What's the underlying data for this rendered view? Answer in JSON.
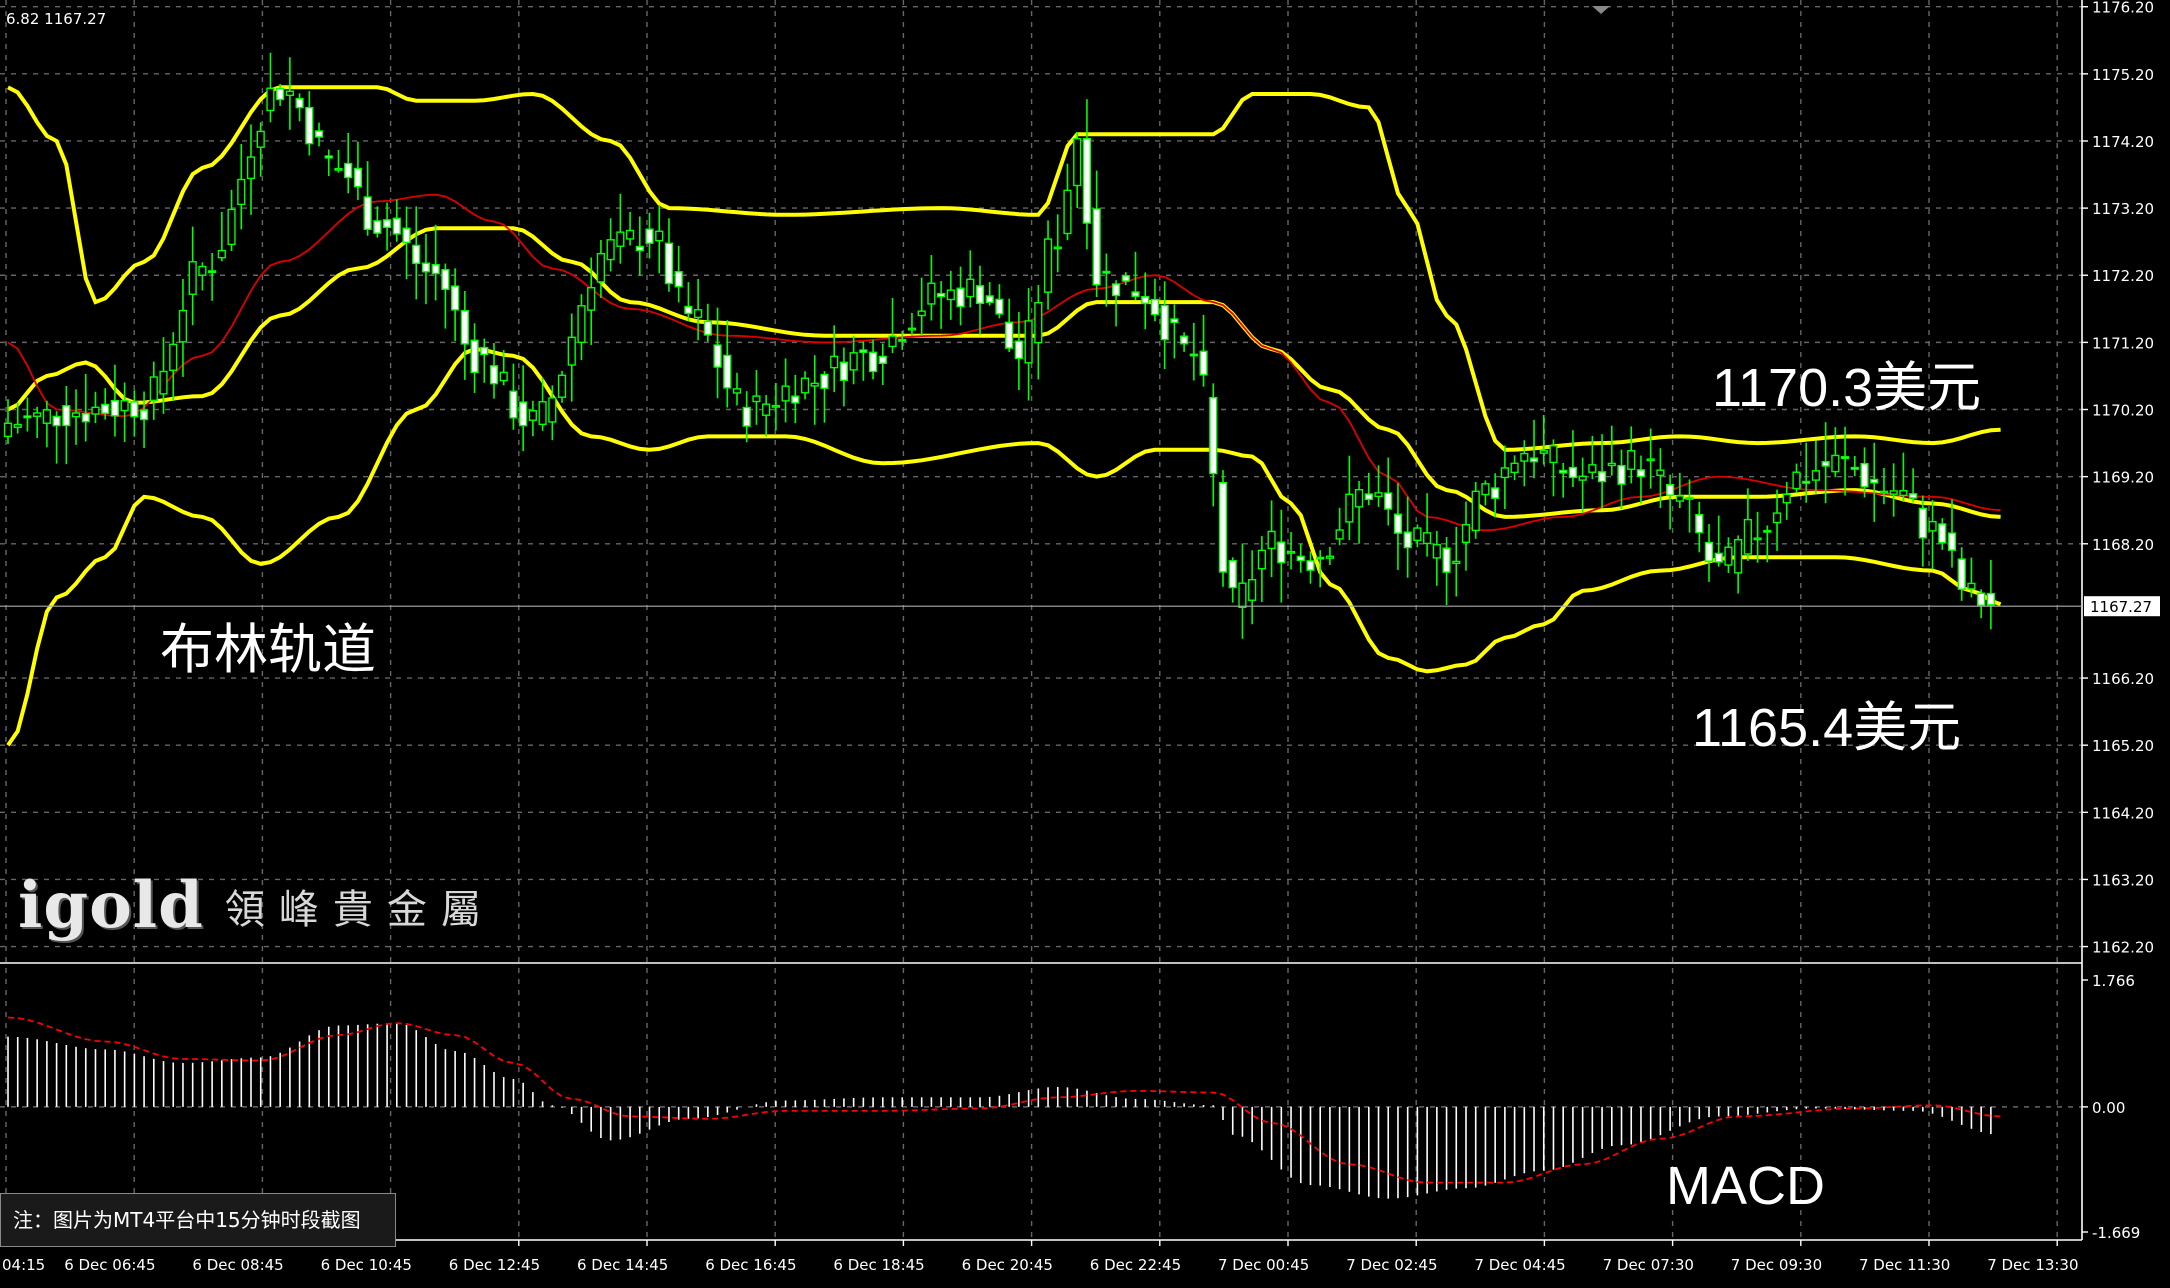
{
  "header": {
    "ohlc_readout": "6.82 1167.27"
  },
  "annotations": {
    "bollinger_label": "布林轨道",
    "upper_value": "1170.3美元",
    "lower_value": "1165.4美元",
    "macd_label": "MACD"
  },
  "note": "注：图片为MT4平台中15分钟时段截图",
  "logo": {
    "main": "igold",
    "sub": "領峰貴金屬"
  },
  "colors": {
    "background": "#000000",
    "grid": "#666666",
    "bull": "#00ff00",
    "bear": "#ffffff",
    "bollinger": "#ffff00",
    "ma": "#dd0000",
    "macd_hist": "#ffffff",
    "macd_signal": "#ff0000"
  },
  "chart_data": {
    "type": "candlestick",
    "price_axis": {
      "ticks": [
        "1176.20",
        "1175.20",
        "1174.20",
        "1173.20",
        "1172.20",
        "1171.20",
        "1170.20",
        "1169.20",
        "1168.20",
        "1167.27",
        "1166.20",
        "1165.20",
        "1164.20",
        "1163.20",
        "1162.20"
      ],
      "ylim": [
        1162.0,
        1176.3
      ],
      "current_price": 1167.27,
      "current_label": "1167.27"
    },
    "macd_axis": {
      "ticks": [
        "1.766",
        "0.00",
        "-1.669"
      ],
      "ylim": [
        -1.669,
        1.766
      ]
    },
    "time_labels": [
      "04:15",
      "6 Dec 06:45",
      "6 Dec 08:45",
      "6 Dec 10:45",
      "6 Dec 12:45",
      "6 Dec 14:45",
      "6 Dec 16:45",
      "6 Dec 18:45",
      "6 Dec 20:45",
      "6 Dec 22:45",
      "7 Dec 00:45",
      "7 Dec 02:45",
      "7 Dec 04:45",
      "7 Dec 07:30",
      "7 Dec 09:30",
      "7 Dec 11:30",
      "7 Dec 13:30"
    ],
    "anchors": {
      "close": [
        [
          0,
          1170.0
        ],
        [
          8,
          1170.2
        ],
        [
          14,
          1170.3
        ],
        [
          20,
          1172.3
        ],
        [
          28,
          1175.0
        ],
        [
          34,
          1173.8
        ],
        [
          38,
          1173.0
        ],
        [
          44,
          1172.2
        ],
        [
          48,
          1171.0
        ],
        [
          54,
          1170.0
        ],
        [
          62,
          1172.6
        ],
        [
          66,
          1172.8
        ],
        [
          70,
          1171.6
        ],
        [
          76,
          1170.2
        ],
        [
          82,
          1170.6
        ],
        [
          88,
          1171.0
        ],
        [
          96,
          1171.9
        ],
        [
          100,
          1172.0
        ],
        [
          104,
          1171.0
        ],
        [
          108,
          1172.8
        ],
        [
          110,
          1174.3
        ],
        [
          112,
          1172.2
        ],
        [
          116,
          1172.0
        ],
        [
          122,
          1171.0
        ],
        [
          126,
          1167.3
        ],
        [
          130,
          1168.2
        ],
        [
          134,
          1168.0
        ],
        [
          140,
          1169.0
        ],
        [
          144,
          1168.2
        ],
        [
          148,
          1168.0
        ],
        [
          152,
          1169.0
        ],
        [
          156,
          1169.6
        ],
        [
          162,
          1169.2
        ],
        [
          168,
          1169.4
        ],
        [
          172,
          1168.8
        ],
        [
          176,
          1167.8
        ],
        [
          180,
          1168.4
        ],
        [
          184,
          1169.2
        ],
        [
          188,
          1169.4
        ],
        [
          194,
          1169.0
        ],
        [
          198,
          1168.4
        ],
        [
          202,
          1167.4
        ],
        [
          205,
          1167.27
        ]
      ],
      "upper_band": [
        [
          0,
          1175.0
        ],
        [
          5,
          1174.2
        ],
        [
          9,
          1171.8
        ],
        [
          14,
          1172.4
        ],
        [
          20,
          1173.8
        ],
        [
          28,
          1175.0
        ],
        [
          38,
          1175.0
        ],
        [
          42,
          1174.8
        ],
        [
          48,
          1174.8
        ],
        [
          54,
          1174.9
        ],
        [
          62,
          1174.2
        ],
        [
          68,
          1173.2
        ],
        [
          80,
          1173.1
        ],
        [
          96,
          1173.2
        ],
        [
          106,
          1173.1
        ],
        [
          110,
          1174.3
        ],
        [
          116,
          1174.3
        ],
        [
          124,
          1174.3
        ],
        [
          128,
          1174.9
        ],
        [
          134,
          1174.9
        ],
        [
          140,
          1174.7
        ],
        [
          144,
          1173.2
        ],
        [
          148,
          1171.6
        ],
        [
          154,
          1169.6
        ],
        [
          164,
          1169.7
        ],
        [
          172,
          1169.8
        ],
        [
          180,
          1169.7
        ],
        [
          190,
          1169.8
        ],
        [
          198,
          1169.7
        ],
        [
          205,
          1169.9
        ]
      ],
      "middle_band": [
        [
          0,
          1170.2
        ],
        [
          4,
          1170.7
        ],
        [
          8,
          1170.9
        ],
        [
          13,
          1170.3
        ],
        [
          20,
          1170.4
        ],
        [
          28,
          1171.6
        ],
        [
          36,
          1172.3
        ],
        [
          44,
          1172.9
        ],
        [
          52,
          1172.9
        ],
        [
          58,
          1172.4
        ],
        [
          64,
          1171.8
        ],
        [
          72,
          1171.5
        ],
        [
          84,
          1171.3
        ],
        [
          96,
          1171.3
        ],
        [
          106,
          1171.3
        ],
        [
          112,
          1171.8
        ],
        [
          118,
          1171.8
        ],
        [
          124,
          1171.8
        ],
        [
          130,
          1171.1
        ],
        [
          136,
          1170.5
        ],
        [
          142,
          1169.9
        ],
        [
          148,
          1169.0
        ],
        [
          154,
          1168.6
        ],
        [
          164,
          1168.7
        ],
        [
          172,
          1168.9
        ],
        [
          180,
          1168.9
        ],
        [
          190,
          1169.0
        ],
        [
          198,
          1168.8
        ],
        [
          205,
          1168.6
        ]
      ],
      "lower_band": [
        [
          0,
          1165.2
        ],
        [
          5,
          1167.4
        ],
        [
          10,
          1168.0
        ],
        [
          14,
          1168.9
        ],
        [
          20,
          1168.6
        ],
        [
          26,
          1167.9
        ],
        [
          34,
          1168.6
        ],
        [
          42,
          1170.2
        ],
        [
          48,
          1171.1
        ],
        [
          52,
          1171.0
        ],
        [
          60,
          1169.8
        ],
        [
          66,
          1169.6
        ],
        [
          72,
          1169.8
        ],
        [
          80,
          1169.8
        ],
        [
          90,
          1169.4
        ],
        [
          106,
          1169.7
        ],
        [
          112,
          1169.2
        ],
        [
          118,
          1169.6
        ],
        [
          124,
          1169.6
        ],
        [
          128,
          1169.5
        ],
        [
          132,
          1168.8
        ],
        [
          136,
          1167.6
        ],
        [
          142,
          1166.5
        ],
        [
          146,
          1166.3
        ],
        [
          150,
          1166.4
        ],
        [
          154,
          1166.8
        ],
        [
          158,
          1167.0
        ],
        [
          162,
          1167.5
        ],
        [
          170,
          1167.8
        ],
        [
          178,
          1168.0
        ],
        [
          188,
          1168.0
        ],
        [
          198,
          1167.8
        ],
        [
          202,
          1167.5
        ],
        [
          205,
          1167.3
        ]
      ],
      "moving_average": [
        [
          0,
          1171.2
        ],
        [
          5,
          1170.2
        ],
        [
          12,
          1170.1
        ],
        [
          20,
          1171.0
        ],
        [
          28,
          1172.4
        ],
        [
          38,
          1173.3
        ],
        [
          44,
          1173.4
        ],
        [
          50,
          1173.0
        ],
        [
          56,
          1172.3
        ],
        [
          64,
          1171.7
        ],
        [
          74,
          1171.3
        ],
        [
          84,
          1171.2
        ],
        [
          96,
          1171.3
        ],
        [
          104,
          1171.5
        ],
        [
          112,
          1172.0
        ],
        [
          118,
          1172.2
        ],
        [
          124,
          1171.8
        ],
        [
          130,
          1171.1
        ],
        [
          136,
          1170.3
        ],
        [
          142,
          1169.2
        ],
        [
          146,
          1168.6
        ],
        [
          152,
          1168.4
        ],
        [
          160,
          1168.6
        ],
        [
          168,
          1168.9
        ],
        [
          176,
          1169.2
        ],
        [
          186,
          1169.0
        ],
        [
          198,
          1168.9
        ],
        [
          205,
          1168.7
        ]
      ],
      "macd_hist": [
        [
          0,
          0.88
        ],
        [
          10,
          0.72
        ],
        [
          18,
          0.55
        ],
        [
          26,
          0.62
        ],
        [
          34,
          1.02
        ],
        [
          40,
          1.05
        ],
        [
          46,
          0.7
        ],
        [
          52,
          0.35
        ],
        [
          56,
          0.02
        ],
        [
          62,
          -0.42
        ],
        [
          70,
          -0.15
        ],
        [
          80,
          0.08
        ],
        [
          90,
          0.12
        ],
        [
          100,
          0.12
        ],
        [
          108,
          0.25
        ],
        [
          116,
          0.1
        ],
        [
          124,
          0.02
        ],
        [
          126,
          -0.35
        ],
        [
          134,
          -0.98
        ],
        [
          142,
          -1.15
        ],
        [
          150,
          -1.02
        ],
        [
          158,
          -0.8
        ],
        [
          166,
          -0.48
        ],
        [
          176,
          -0.12
        ],
        [
          186,
          -0.02
        ],
        [
          196,
          -0.05
        ],
        [
          205,
          -0.35
        ]
      ],
      "macd_signal": [
        [
          0,
          1.12
        ],
        [
          10,
          0.82
        ],
        [
          18,
          0.6
        ],
        [
          26,
          0.58
        ],
        [
          34,
          0.9
        ],
        [
          40,
          1.05
        ],
        [
          46,
          0.9
        ],
        [
          52,
          0.55
        ],
        [
          58,
          0.1
        ],
        [
          64,
          -0.12
        ],
        [
          72,
          -0.15
        ],
        [
          80,
          -0.05
        ],
        [
          90,
          -0.05
        ],
        [
          100,
          -0.02
        ],
        [
          108,
          0.12
        ],
        [
          116,
          0.2
        ],
        [
          124,
          0.18
        ],
        [
          130,
          -0.2
        ],
        [
          138,
          -0.72
        ],
        [
          146,
          -0.95
        ],
        [
          154,
          -0.95
        ],
        [
          162,
          -0.72
        ],
        [
          170,
          -0.4
        ],
        [
          178,
          -0.12
        ],
        [
          190,
          -0.02
        ],
        [
          198,
          0.02
        ],
        [
          205,
          -0.12
        ]
      ]
    }
  }
}
